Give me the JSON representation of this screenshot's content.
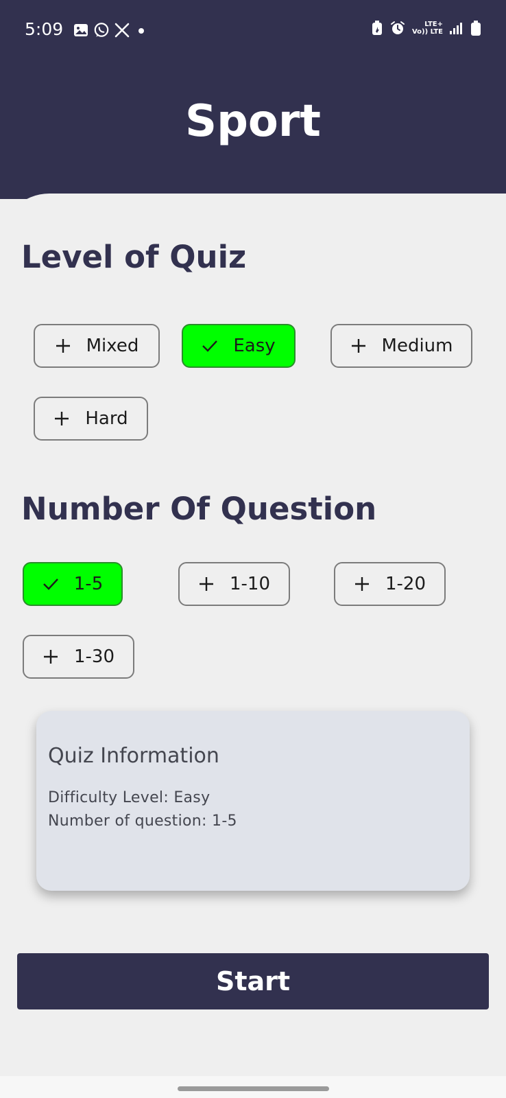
{
  "status_bar": {
    "time": "5:09",
    "lte_top": "LTE+",
    "vo_lte": "Vo)) LTE",
    "icons_left": [
      "gallery-icon",
      "whatsapp-icon",
      "x-icon",
      "dot-icon"
    ],
    "icons_right": [
      "battery-saver-icon",
      "alarm-icon",
      "volte-icon",
      "signal-icon",
      "battery-icon"
    ]
  },
  "header": {
    "title": "Sport"
  },
  "level_section": {
    "title": "Level of Quiz",
    "chips": [
      {
        "label": "Mixed",
        "selected": false
      },
      {
        "label": "Easy",
        "selected": true
      },
      {
        "label": "Medium",
        "selected": false
      },
      {
        "label": "Hard",
        "selected": false
      }
    ]
  },
  "question_section": {
    "title": "Number Of Question",
    "chips": [
      {
        "label": "1-5",
        "selected": true
      },
      {
        "label": "1-10",
        "selected": false
      },
      {
        "label": "1-20",
        "selected": false
      },
      {
        "label": "1-30",
        "selected": false
      }
    ]
  },
  "info_card": {
    "title": "Quiz Information",
    "difficulty_line": "Difficulty Level: Easy",
    "questions_line": "Number of question: 1-5"
  },
  "start_button": {
    "label": "Start"
  },
  "colors": {
    "header_bg": "#32314f",
    "sheet_bg": "#efefef",
    "selected_chip": "#00ff00",
    "card_bg": "#e0e3ea",
    "button_bg": "#32314f"
  }
}
